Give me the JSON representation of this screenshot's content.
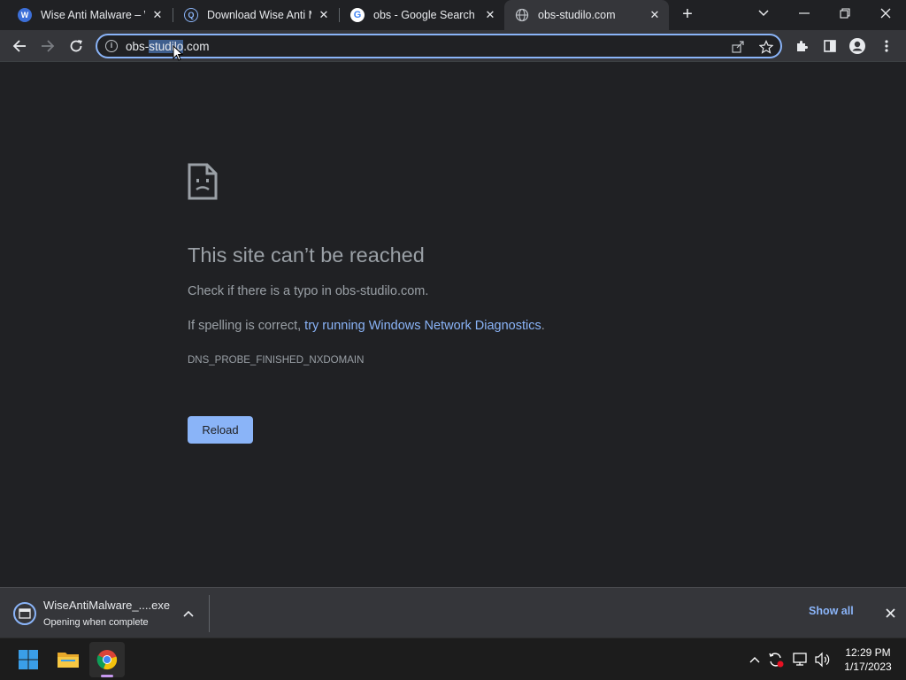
{
  "browser": {
    "tabs": [
      {
        "title": "Wise Anti Malware – W",
        "icon": "wise-favicon",
        "active": false
      },
      {
        "title": "Download Wise Anti M",
        "icon": "download-site-favicon",
        "active": false
      },
      {
        "title": "obs - Google Search",
        "icon": "google-favicon",
        "active": false
      },
      {
        "title": "obs-studilo.com",
        "icon": "globe-favicon",
        "active": true
      }
    ],
    "url": {
      "before": "obs-",
      "selected": "studilo",
      "after": ".com"
    }
  },
  "error_page": {
    "title": "This site can’t be reached",
    "check_typo": "Check if there is a typo in obs-studilo.com.",
    "spelling_prefix": "If spelling is correct, ",
    "diagnostics_link": "try running Windows Network Diagnostics",
    "spelling_suffix": ".",
    "error_code": "DNS_PROBE_FINISHED_NXDOMAIN",
    "reload_label": "Reload"
  },
  "download_shelf": {
    "file_name": "WiseAntiMalware_....exe",
    "status": "Opening when complete",
    "show_all": "Show all"
  },
  "taskbar": {
    "time": "12:29 PM",
    "date": "1/17/2023"
  },
  "colors": {
    "accent": "#8ab4f8",
    "page_bg": "#202124",
    "toolbar_bg": "#35363a"
  }
}
